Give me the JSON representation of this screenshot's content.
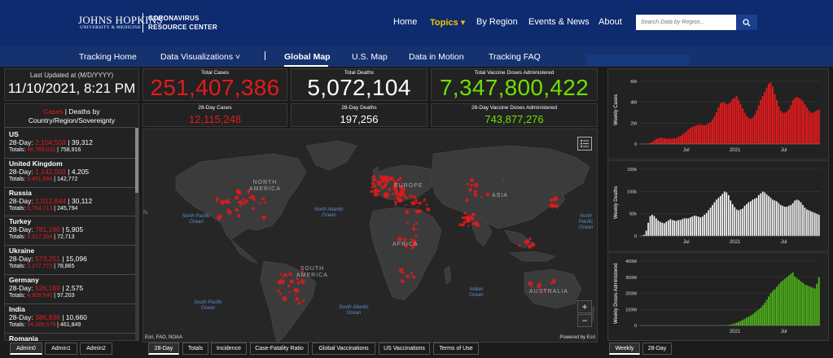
{
  "header": {
    "logo_main": "JOHNS HOPKINS",
    "logo_sub": "UNIVERSITY & MEDICINE",
    "center_line1": "CORONAVIRUS",
    "center_line2": "RESOURCE CENTER",
    "nav": [
      {
        "label": "Home",
        "active": false
      },
      {
        "label": "Topics ▾",
        "active": true
      },
      {
        "label": "By Region",
        "active": false
      },
      {
        "label": "Events & News",
        "active": false
      },
      {
        "label": "About",
        "active": false
      }
    ],
    "search_placeholder": "Search Data by Region..."
  },
  "subnav": [
    "Tracking Home",
    "Data Visualizations ˅",
    "Global Map",
    "U.S. Map",
    "Data in Motion",
    "Tracking FAQ"
  ],
  "dashboard": {
    "last_updated_label": "Last Updated at (M/D/YYYY)",
    "last_updated": "11/10/2021, 8:21 PM",
    "total_cases_label": "Total Cases",
    "total_cases": "251,407,386",
    "total_deaths_label": "Total Deaths",
    "total_deaths": "5,072,104",
    "total_vaccine_label": "Total Vaccine Doses Administered",
    "total_vaccine": "7,347,800,422",
    "cases28_label": "28-Day Cases",
    "cases28": "12,115,248",
    "deaths28_label": "28-Day Deaths",
    "deaths28": "197,256",
    "vaccine28_label": "28-Day Vaccine Doses Administered",
    "vaccine28": "743,877,276"
  },
  "country_list": {
    "head_cases": "Cases",
    "head_sep": " | Deaths by",
    "head_line2": "Country/Region/Sovereignty",
    "prefix_28": "28-Day: ",
    "prefix_totals": "Totals: ",
    "items": [
      {
        "name": "US",
        "d28_cases": "2,104,503",
        "d28_deaths": "39,312",
        "t_cases": "46,769,031",
        "t_deaths": "758,916"
      },
      {
        "name": "United Kingdom",
        "d28_cases": "1,142,003",
        "d28_deaths": "4,205",
        "t_cases": "9,451,884",
        "t_deaths": "142,772"
      },
      {
        "name": "Russia",
        "d28_cases": "1,012,844",
        "d28_deaths": "30,112",
        "t_cases": "8,764,713",
        "t_deaths": "245,794"
      },
      {
        "name": "Turkey",
        "d28_cases": "781,190",
        "d28_deaths": "5,905",
        "t_cases": "8,317,394",
        "t_deaths": "72,713"
      },
      {
        "name": "Ukraine",
        "d28_cases": "573,251",
        "d28_deaths": "15,096",
        "t_cases": "3,277,773",
        "t_deaths": "78,865"
      },
      {
        "name": "Germany",
        "d28_cases": "526,189",
        "d28_deaths": "2,575",
        "t_cases": "4,908,540",
        "t_deaths": "97,203"
      },
      {
        "name": "India",
        "d28_cases": "386,836",
        "d28_deaths": "10,660",
        "t_cases": "34,388,579",
        "t_deaths": "461,849"
      },
      {
        "name": "Romania",
        "d28_cases": "",
        "d28_deaths": "",
        "t_cases": "",
        "t_deaths": ""
      }
    ]
  },
  "map": {
    "continents": [
      "NORTH\nAMERICA",
      "EUROPE",
      "ASIA",
      "AFRICA",
      "SOUTH\nAMERICA",
      "AUSTRALIA"
    ],
    "oceans": [
      "North Pacific\nOcean",
      "North Atlantic\nOcean",
      "South Pacific\nOcean",
      "South Atlantic\nOcean",
      "Indian\nOcean",
      "North Pacific\nOcean",
      "fic"
    ],
    "attribution_left": "Esri, FAO, NOAA",
    "attribution_right": "Powered by Esri",
    "zoom_in": "+",
    "zoom_out": "−"
  },
  "tabs": {
    "left": [
      "Admin0",
      "Admin1",
      "Admin2"
    ],
    "center": [
      "28-Day",
      "Totals",
      "Incidence",
      "Case-Fatality Ratio",
      "Global Vaccinations",
      "US Vaccinations",
      "Terms of Use"
    ],
    "right": [
      "Weekly",
      "28-Day"
    ]
  },
  "colors": {
    "cases": "#e41a1c",
    "deaths": "#ffffff",
    "vaccines": "#4caf1a",
    "header": "#0d2b6e"
  },
  "chart_data": [
    {
      "type": "bar",
      "ylabel": "Weekly Cases",
      "yticks": [
        "0",
        "2M",
        "4M",
        "6M"
      ],
      "ylim": [
        0,
        6400000
      ],
      "xticks": [
        "Jul",
        "2021",
        "Jul"
      ],
      "values": [
        0.001,
        0.003,
        0.01,
        0.03,
        0.05,
        0.1,
        0.2,
        0.35,
        0.48,
        0.55,
        0.6,
        0.58,
        0.55,
        0.52,
        0.5,
        0.5,
        0.52,
        0.55,
        0.6,
        0.68,
        0.78,
        0.9,
        1.05,
        1.2,
        1.4,
        1.55,
        1.65,
        1.72,
        1.8,
        1.85,
        1.85,
        1.82,
        1.8,
        1.85,
        1.95,
        2.1,
        2.35,
        2.65,
        3.05,
        3.5,
        3.9,
        4.0,
        3.95,
        3.8,
        3.85,
        4.0,
        4.3,
        4.4,
        4.6,
        4.2,
        3.8,
        3.4,
        3.0,
        2.7,
        2.5,
        2.4,
        2.5,
        2.8,
        3.2,
        3.7,
        4.2,
        4.6,
        5.0,
        5.4,
        5.75,
        5.9,
        5.5,
        4.8,
        4.2,
        3.6,
        3.2,
        3.0,
        3.0,
        3.1,
        3.3,
        3.7,
        4.2,
        4.4,
        4.5,
        4.4,
        4.3,
        4.1,
        3.8,
        3.5,
        3.2,
        3.0,
        3.0,
        3.1,
        3.2,
        3.3
      ]
    },
    {
      "type": "bar",
      "ylabel": "Weekly Deaths",
      "yticks": [
        "0",
        "50k",
        "100k",
        "150k"
      ],
      "ylim": [
        0,
        150000
      ],
      "xticks": [
        "Jul",
        "2021",
        "Jul"
      ],
      "values": [
        0.5,
        1,
        3,
        12,
        30,
        45,
        48,
        45,
        40,
        35,
        32,
        30,
        29,
        32,
        35,
        38,
        36,
        35,
        34,
        36,
        36,
        38,
        40,
        40,
        40,
        42,
        44,
        46,
        45,
        44,
        42,
        44,
        48,
        52,
        58,
        64,
        70,
        76,
        82,
        86,
        90,
        95,
        100,
        98,
        92,
        80,
        72,
        65,
        60,
        58,
        60,
        62,
        68,
        72,
        76,
        78,
        82,
        84,
        86,
        92,
        96,
        100,
        98,
        94,
        90,
        86,
        82,
        80,
        78,
        74,
        70,
        68,
        66,
        66,
        68,
        70,
        74,
        80,
        82,
        80,
        76,
        70,
        64,
        60,
        58,
        56,
        54,
        52,
        50,
        48
      ]
    },
    {
      "type": "bar",
      "ylabel": "Weekly Doses Administered",
      "yticks": [
        "0",
        "100M",
        "200M",
        "300M",
        "400M"
      ],
      "ylim": [
        0,
        400000000
      ],
      "xticks": [
        "2021",
        "Jul"
      ],
      "values": [
        0,
        0,
        0,
        0,
        0,
        0,
        0,
        0,
        0,
        0,
        0,
        0,
        0,
        0,
        0,
        0,
        0,
        0,
        0,
        0,
        0,
        0,
        0,
        0,
        0,
        0,
        0,
        0,
        0,
        0,
        0,
        0,
        0,
        0,
        0,
        0,
        0,
        0,
        0,
        0,
        0,
        0.5,
        1,
        2,
        3,
        5,
        8,
        12,
        17,
        22,
        28,
        34,
        40,
        48,
        55,
        62,
        70,
        80,
        90,
        100,
        110,
        125,
        140,
        160,
        180,
        200,
        215,
        225,
        240,
        255,
        270,
        280,
        290,
        300,
        310,
        320,
        330,
        305,
        295,
        285,
        275,
        265,
        255,
        250,
        245,
        240,
        235,
        230,
        260,
        300
      ]
    }
  ]
}
